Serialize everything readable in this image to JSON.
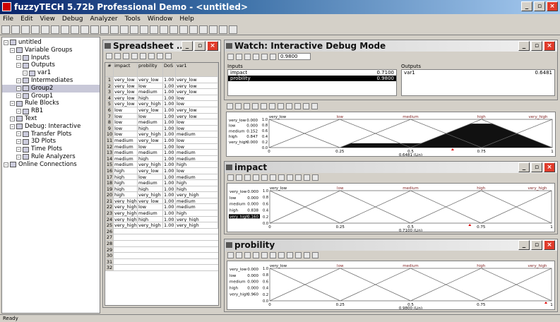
{
  "window": {
    "title": "fuzzyTECH 5.72b Professional Demo - <untitled>"
  },
  "menu": [
    "File",
    "Edit",
    "View",
    "Debug",
    "Analyzer",
    "Tools",
    "Window",
    "Help"
  ],
  "tree": [
    {
      "label": "untitled",
      "indent": 0,
      "icon": "project-icon"
    },
    {
      "label": "Variable Groups",
      "indent": 1,
      "icon": "folder-icon"
    },
    {
      "label": "Inputs",
      "indent": 2,
      "icon": "folder-icon"
    },
    {
      "label": "Outputs",
      "indent": 2,
      "icon": "folder-icon"
    },
    {
      "label": "var1",
      "indent": 3,
      "icon": "variable-icon"
    },
    {
      "label": "Intermediates",
      "indent": 2,
      "icon": "folder-icon"
    },
    {
      "label": "Group2",
      "indent": 2,
      "icon": "group-icon"
    },
    {
      "label": "Group1",
      "indent": 2,
      "icon": "group-icon"
    },
    {
      "label": "Rule Blocks",
      "indent": 1,
      "icon": "folder-icon"
    },
    {
      "label": "RB1",
      "indent": 2,
      "icon": "rule-block-icon"
    },
    {
      "label": "Text",
      "indent": 1,
      "icon": "text-icon"
    },
    {
      "label": "Debug: Interactive",
      "indent": 1,
      "icon": "debug-icon"
    },
    {
      "label": "Transfer Plots",
      "indent": 2,
      "icon": "plot-icon"
    },
    {
      "label": "3D Plots",
      "indent": 2,
      "icon": "plot-icon"
    },
    {
      "label": "Time Plots",
      "indent": 2,
      "icon": "plot-icon"
    },
    {
      "label": "Rule Analyzers",
      "indent": 2,
      "icon": "analyzer-icon"
    },
    {
      "label": "Online Connections",
      "indent": 0,
      "icon": "connection-icon"
    }
  ],
  "spreadsheet": {
    "title": "Spreadsheet ...",
    "headers": [
      "#",
      "impact",
      "probility",
      "DoS",
      "var1"
    ],
    "rows": [
      [
        "1",
        "very_low",
        "very_low",
        "1.00",
        "very_low"
      ],
      [
        "2",
        "very_low",
        "low",
        "1.00",
        "very_low"
      ],
      [
        "3",
        "very_low",
        "medium",
        "1.00",
        "very_low"
      ],
      [
        "4",
        "very_low",
        "high",
        "1.00",
        "low"
      ],
      [
        "5",
        "very_low",
        "very_high",
        "1.00",
        "low"
      ],
      [
        "6",
        "low",
        "very_low",
        "1.00",
        "very_low"
      ],
      [
        "7",
        "low",
        "low",
        "1.00",
        "very_low"
      ],
      [
        "8",
        "low",
        "medium",
        "1.00",
        "low"
      ],
      [
        "9",
        "low",
        "high",
        "1.00",
        "low"
      ],
      [
        "10",
        "low",
        "very_high",
        "1.00",
        "medium"
      ],
      [
        "11",
        "medium",
        "very_low",
        "1.00",
        "low"
      ],
      [
        "12",
        "medium",
        "low",
        "1.00",
        "low"
      ],
      [
        "13",
        "medium",
        "medium",
        "1.00",
        "medium"
      ],
      [
        "14",
        "medium",
        "high",
        "1.00",
        "medium"
      ],
      [
        "15",
        "medium",
        "very_high",
        "1.00",
        "high"
      ],
      [
        "16",
        "high",
        "very_low",
        "1.00",
        "low"
      ],
      [
        "17",
        "high",
        "low",
        "1.00",
        "medium"
      ],
      [
        "18",
        "high",
        "medium",
        "1.00",
        "high"
      ],
      [
        "19",
        "high",
        "high",
        "1.00",
        "high"
      ],
      [
        "20",
        "high",
        "very_high",
        "1.00",
        "very_high"
      ],
      [
        "21",
        "very_high",
        "very_low",
        "1.00",
        "medium"
      ],
      [
        "22",
        "very_high",
        "low",
        "1.00",
        "medium"
      ],
      [
        "23",
        "very_high",
        "medium",
        "1.00",
        "high"
      ],
      [
        "24",
        "very_high",
        "high",
        "1.00",
        "very_high"
      ],
      [
        "25",
        "very_high",
        "very_high",
        "1.00",
        "very_high"
      ]
    ]
  },
  "watch": {
    "title": "Watch: Interactive Debug Mode",
    "value_box": "0.9800",
    "inputs_label": "Inputs",
    "outputs_label": "Outputs",
    "inputs": [
      {
        "name": "impact",
        "value": "0.7100"
      },
      {
        "name": "probility",
        "value": "0.9800"
      }
    ],
    "outputs": [
      {
        "name": "var1",
        "value": "0.6481"
      }
    ]
  },
  "panels": [
    {
      "title": "var1",
      "terms": [
        "very_low",
        "low",
        "medium",
        "high",
        "very_high"
      ],
      "term_values": [
        "0.000",
        "0.000",
        "0.152",
        "0.847",
        "0.000"
      ],
      "xticks": [
        "0",
        "0.25",
        "0.5",
        "0.75",
        "1"
      ],
      "xlabel": "0.6481 (Lin)",
      "yticks": [
        "1.0",
        "0.8",
        "0.6",
        "0.4",
        "0.2",
        "0.0"
      ]
    },
    {
      "title": "impact",
      "terms": [
        "very_low",
        "low",
        "medium",
        "high",
        "very_high"
      ],
      "term_values": [
        "0.000",
        "0.000",
        "0.000",
        "0.838",
        "0.160"
      ],
      "xticks": [
        "0",
        "0.25",
        "0.5",
        "0.75",
        "1"
      ],
      "xlabel": "0.7100 (Lin)",
      "yticks": [
        "1.0",
        "0.8",
        "0.6",
        "0.4",
        "0.2",
        "0.0"
      ]
    },
    {
      "title": "probility",
      "terms": [
        "very_low",
        "low",
        "medium",
        "high",
        "very_high"
      ],
      "term_values": [
        "0.000",
        "0.000",
        "0.000",
        "0.000",
        "0.960"
      ],
      "xticks": [
        "0",
        "0.25",
        "0.5",
        "0.75",
        "1"
      ],
      "xlabel": "0.9800 (Lin)",
      "yticks": [
        "1.0",
        "0.8",
        "0.6",
        "0.4",
        "0.2",
        "0.0"
      ]
    }
  ],
  "status": {
    "left": "Ready"
  }
}
